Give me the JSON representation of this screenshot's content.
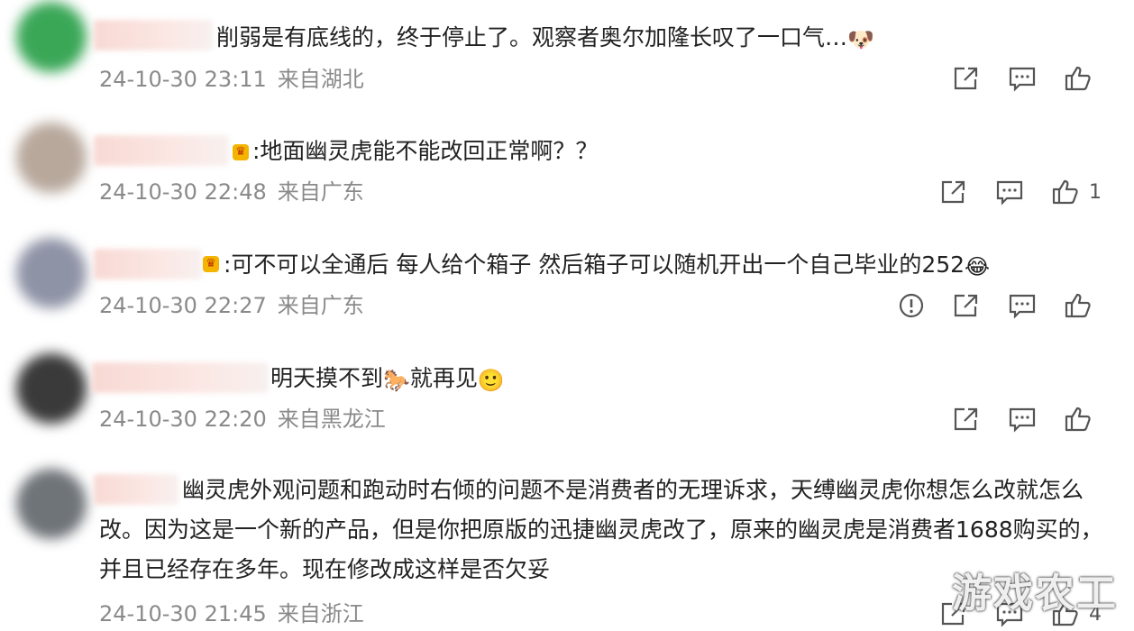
{
  "comments": [
    {
      "text": "削弱是有底线的，终于停止了。观察者奥尔加隆长叹了一口气…",
      "emoji": "🐶",
      "time": "24-10-30 23:11",
      "location": "来自湖北",
      "likes": "",
      "avatar_color": "#3aa757"
    },
    {
      "text": ":地面幽灵虎能不能改回正常啊？？",
      "time": "24-10-30 22:48",
      "location": "来自广东",
      "likes": "1",
      "avatar_color": "#b8a89c"
    },
    {
      "text": ":可不可以全通后 每人给个箱子 然后箱子可以随机开出一个自己毕业的252",
      "emoji": "😂",
      "time": "24-10-30 22:27",
      "location": "来自广东",
      "likes": "",
      "avatar_color": "#8f93a6"
    },
    {
      "text_a": "明天摸不到",
      "emoji_mid": "🐎",
      "text_b": "就再见",
      "emoji": "🙂",
      "time": "24-10-30 22:20",
      "location": "来自黑龙江",
      "likes": "",
      "avatar_color": "#3a3a3a"
    },
    {
      "text": "幽灵虎外观问题和跑动时右倾的问题不是消费者的无理诉求，天缚幽灵虎你想怎么改就怎么改。因为这是一个新的产品，但是你把原版的迅捷幽灵虎改了，原来的幽灵虎是消费者1688购买的，并且已经存在多年。现在修改成这样是否欠妥",
      "time": "24-10-30 21:45",
      "location": "来自浙江",
      "likes": "4",
      "avatar_color": "#6f7479"
    }
  ],
  "watermark": "游戏农工",
  "icons": [
    "share-icon",
    "comment-icon",
    "like-icon",
    "report-icon"
  ]
}
